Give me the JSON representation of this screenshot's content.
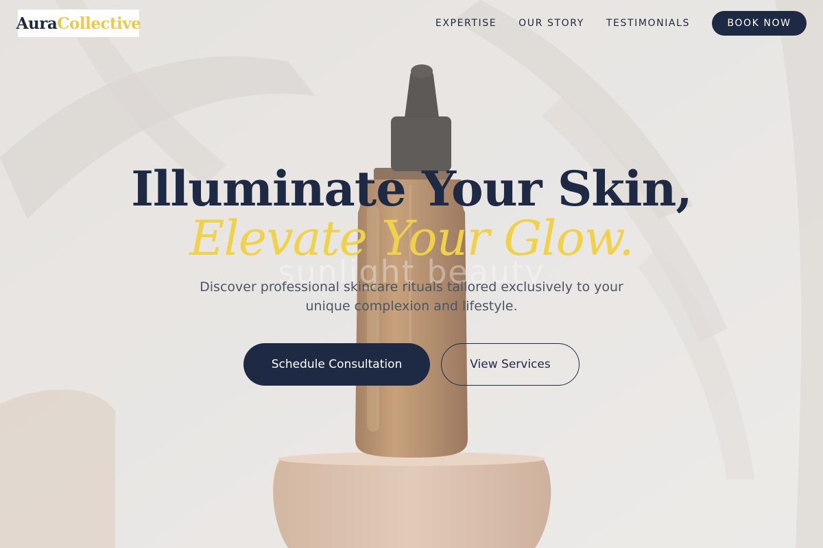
{
  "brand": {
    "logo_part1": "Aura",
    "logo_part2": "Collective"
  },
  "nav": {
    "links": [
      "EXPERTISE",
      "OUR STORY",
      "TESTIMONIALS"
    ],
    "cta": "BOOK NOW"
  },
  "hero": {
    "headline_line1": "Illuminate Your Skin,",
    "headline_line2": "Elevate Your Glow.",
    "background_caption": "sunlight beauty",
    "subtitle": "Discover professional skincare rituals tailored exclusively to your unique complexion and lifestyle.",
    "primary_button": "Schedule Consultation",
    "secondary_button": "View Services"
  },
  "colors": {
    "navy": "#1e2a44",
    "gold": "#f0d24a",
    "background": "#e7e5e2"
  },
  "icons": {
    "hero_image": "amber-dropper-bottle"
  }
}
